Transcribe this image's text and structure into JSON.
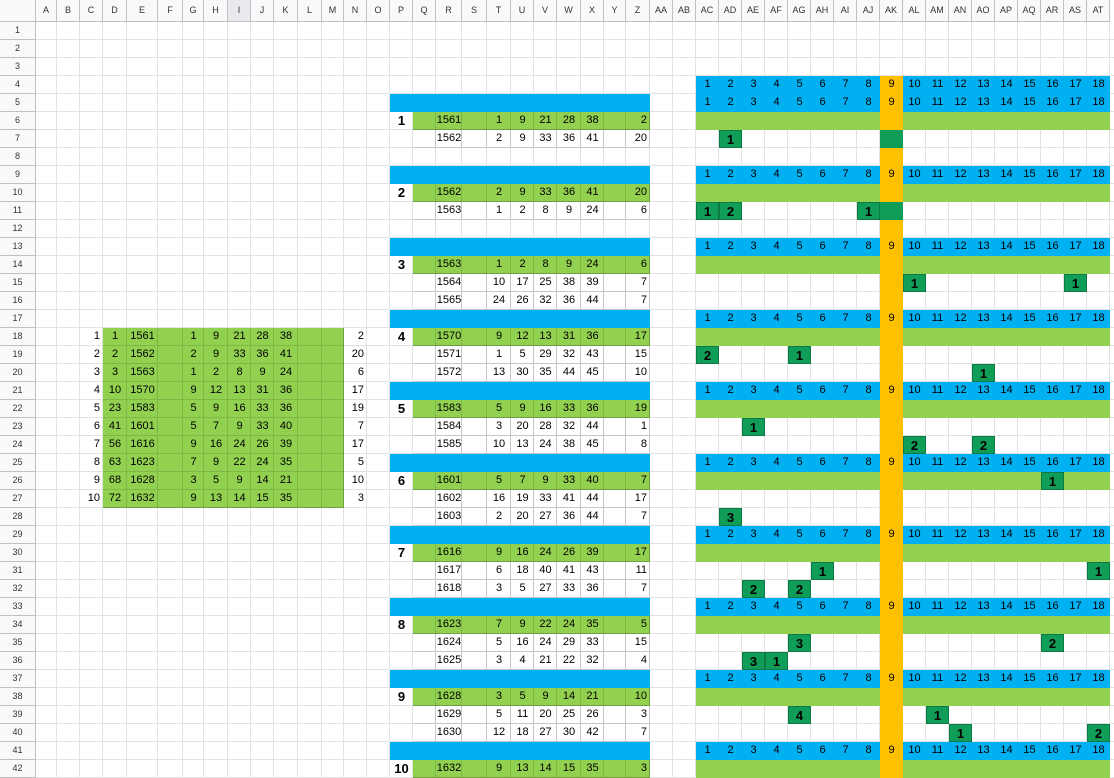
{
  "colors": {
    "green": "#92d050",
    "blue": "#00b0f0",
    "orange": "#ffc000",
    "mark": "#0f9d58",
    "header": "#f8f9fa"
  },
  "columns": [
    "A",
    "B",
    "C",
    "D",
    "E",
    "F",
    "G",
    "H",
    "I",
    "J",
    "K",
    "L",
    "M",
    "N",
    "O",
    "P",
    "Q",
    "R",
    "S",
    "T",
    "U",
    "V",
    "W",
    "X",
    "Y",
    "Z",
    "AA",
    "AB",
    "AC",
    "AD",
    "AE",
    "AF",
    "AG",
    "AH",
    "AI",
    "AJ",
    "AK",
    "AL",
    "AM",
    "AN",
    "AO",
    "AP",
    "AQ",
    "AR",
    "AS",
    "AT"
  ],
  "selected_column": "I",
  "row_numbers": [
    1,
    2,
    3,
    4,
    5,
    6,
    7,
    8,
    9,
    10,
    11,
    12,
    13,
    14,
    15,
    16,
    17,
    18,
    19,
    20,
    21,
    22,
    23,
    24,
    25,
    26,
    27,
    28,
    29,
    30,
    31,
    32,
    33,
    34,
    35,
    36,
    37,
    38,
    39,
    40,
    41,
    42
  ],
  "summary_table": [
    {
      "idx": "1",
      "n": "1",
      "draw": "1561",
      "nums": [
        "1",
        "9",
        "21",
        "28",
        "38"
      ],
      "bonus": "2"
    },
    {
      "idx": "2",
      "n": "2",
      "draw": "1562",
      "nums": [
        "2",
        "9",
        "33",
        "36",
        "41"
      ],
      "bonus": "20"
    },
    {
      "idx": "3",
      "n": "3",
      "draw": "1563",
      "nums": [
        "1",
        "2",
        "8",
        "9",
        "24"
      ],
      "bonus": "6"
    },
    {
      "idx": "4",
      "n": "10",
      "draw": "1570",
      "nums": [
        "9",
        "12",
        "13",
        "31",
        "36"
      ],
      "bonus": "17"
    },
    {
      "idx": "5",
      "n": "23",
      "draw": "1583",
      "nums": [
        "5",
        "9",
        "16",
        "33",
        "36"
      ],
      "bonus": "19"
    },
    {
      "idx": "6",
      "n": "41",
      "draw": "1601",
      "nums": [
        "5",
        "7",
        "9",
        "33",
        "40"
      ],
      "bonus": "7"
    },
    {
      "idx": "7",
      "n": "56",
      "draw": "1616",
      "nums": [
        "9",
        "16",
        "24",
        "26",
        "39"
      ],
      "bonus": "17"
    },
    {
      "idx": "8",
      "n": "63",
      "draw": "1623",
      "nums": [
        "7",
        "9",
        "22",
        "24",
        "35"
      ],
      "bonus": "5"
    },
    {
      "idx": "9",
      "n": "68",
      "draw": "1628",
      "nums": [
        "3",
        "5",
        "9",
        "14",
        "21"
      ],
      "bonus": "10"
    },
    {
      "idx": "10",
      "n": "72",
      "draw": "1632",
      "nums": [
        "9",
        "13",
        "14",
        "15",
        "35"
      ],
      "bonus": "3"
    }
  ],
  "blocks": [
    {
      "label": "1",
      "rows": [
        {
          "draw": "1561",
          "nums": [
            "1",
            "9",
            "21",
            "28",
            "38"
          ],
          "bonus": "2"
        },
        {
          "draw": "1562",
          "nums": [
            "2",
            "9",
            "33",
            "36",
            "41"
          ],
          "bonus": "20"
        }
      ]
    },
    {
      "label": "2",
      "rows": [
        {
          "draw": "1562",
          "nums": [
            "2",
            "9",
            "33",
            "36",
            "41"
          ],
          "bonus": "20"
        },
        {
          "draw": "1563",
          "nums": [
            "1",
            "2",
            "8",
            "9",
            "24"
          ],
          "bonus": "6"
        }
      ]
    },
    {
      "label": "3",
      "rows": [
        {
          "draw": "1563",
          "nums": [
            "1",
            "2",
            "8",
            "9",
            "24"
          ],
          "bonus": "6"
        },
        {
          "draw": "1564",
          "nums": [
            "10",
            "17",
            "25",
            "38",
            "39"
          ],
          "bonus": "7"
        },
        {
          "draw": "1565",
          "nums": [
            "24",
            "26",
            "32",
            "36",
            "44"
          ],
          "bonus": "7"
        }
      ]
    },
    {
      "label": "4",
      "rows": [
        {
          "draw": "1570",
          "nums": [
            "9",
            "12",
            "13",
            "31",
            "36"
          ],
          "bonus": "17"
        },
        {
          "draw": "1571",
          "nums": [
            "1",
            "5",
            "29",
            "32",
            "43"
          ],
          "bonus": "15"
        },
        {
          "draw": "1572",
          "nums": [
            "13",
            "30",
            "35",
            "44",
            "45"
          ],
          "bonus": "10"
        }
      ]
    },
    {
      "label": "5",
      "rows": [
        {
          "draw": "1583",
          "nums": [
            "5",
            "9",
            "16",
            "33",
            "36"
          ],
          "bonus": "19"
        },
        {
          "draw": "1584",
          "nums": [
            "3",
            "20",
            "28",
            "32",
            "44"
          ],
          "bonus": "1"
        },
        {
          "draw": "1585",
          "nums": [
            "10",
            "13",
            "24",
            "38",
            "45"
          ],
          "bonus": "8"
        }
      ]
    },
    {
      "label": "6",
      "rows": [
        {
          "draw": "1601",
          "nums": [
            "5",
            "7",
            "9",
            "33",
            "40"
          ],
          "bonus": "7"
        },
        {
          "draw": "1602",
          "nums": [
            "16",
            "19",
            "33",
            "41",
            "44"
          ],
          "bonus": "17"
        },
        {
          "draw": "1603",
          "nums": [
            "2",
            "20",
            "27",
            "36",
            "44"
          ],
          "bonus": "7"
        }
      ]
    },
    {
      "label": "7",
      "rows": [
        {
          "draw": "1616",
          "nums": [
            "9",
            "16",
            "24",
            "26",
            "39"
          ],
          "bonus": "17"
        },
        {
          "draw": "1617",
          "nums": [
            "6",
            "18",
            "40",
            "41",
            "43"
          ],
          "bonus": "11"
        },
        {
          "draw": "1618",
          "nums": [
            "3",
            "5",
            "27",
            "33",
            "36"
          ],
          "bonus": "7"
        }
      ]
    },
    {
      "label": "8",
      "rows": [
        {
          "draw": "1623",
          "nums": [
            "7",
            "9",
            "22",
            "24",
            "35"
          ],
          "bonus": "5"
        },
        {
          "draw": "1624",
          "nums": [
            "5",
            "16",
            "24",
            "29",
            "33"
          ],
          "bonus": "15"
        },
        {
          "draw": "1625",
          "nums": [
            "3",
            "4",
            "21",
            "22",
            "32"
          ],
          "bonus": "4"
        }
      ]
    },
    {
      "label": "9",
      "rows": [
        {
          "draw": "1628",
          "nums": [
            "3",
            "5",
            "9",
            "14",
            "21"
          ],
          "bonus": "10"
        },
        {
          "draw": "1629",
          "nums": [
            "5",
            "11",
            "20",
            "25",
            "26"
          ],
          "bonus": "3"
        },
        {
          "draw": "1630",
          "nums": [
            "12",
            "18",
            "27",
            "30",
            "42"
          ],
          "bonus": "7"
        }
      ]
    },
    {
      "label": "10",
      "rows": [
        {
          "draw": "1632",
          "nums": [
            "9",
            "13",
            "14",
            "15",
            "35"
          ],
          "bonus": "3"
        }
      ]
    }
  ],
  "number_header": [
    "1",
    "2",
    "3",
    "4",
    "5",
    "6",
    "7",
    "8",
    "9",
    "10",
    "11",
    "12",
    "13",
    "14",
    "15",
    "16",
    "17",
    "18"
  ],
  "marks": [
    {
      "row": 7,
      "col": "AD",
      "v": "1"
    },
    {
      "row": 11,
      "col": "AC",
      "v": "1"
    },
    {
      "row": 11,
      "col": "AD",
      "v": "2"
    },
    {
      "row": 11,
      "col": "AJ",
      "v": "1"
    },
    {
      "row": 15,
      "col": "AL",
      "v": "1"
    },
    {
      "row": 15,
      "col": "AS",
      "v": "1"
    },
    {
      "row": 19,
      "col": "AC",
      "v": "2"
    },
    {
      "row": 19,
      "col": "AG",
      "v": "1"
    },
    {
      "row": 20,
      "col": "AO",
      "v": "1"
    },
    {
      "row": 23,
      "col": "AE",
      "v": "1"
    },
    {
      "row": 24,
      "col": "AL",
      "v": "2"
    },
    {
      "row": 24,
      "col": "AO",
      "v": "2"
    },
    {
      "row": 26,
      "col": "AR",
      "v": "1"
    },
    {
      "row": 28,
      "col": "AD",
      "v": "3"
    },
    {
      "row": 31,
      "col": "AH",
      "v": "1"
    },
    {
      "row": 31,
      "col": "AT",
      "v": "1"
    },
    {
      "row": 32,
      "col": "AE",
      "v": "2"
    },
    {
      "row": 32,
      "col": "AG",
      "v": "2"
    },
    {
      "row": 35,
      "col": "AG",
      "v": "3"
    },
    {
      "row": 35,
      "col": "AR",
      "v": "2"
    },
    {
      "row": 36,
      "col": "AE",
      "v": "3"
    },
    {
      "row": 36,
      "col": "AF",
      "v": "1"
    },
    {
      "row": 39,
      "col": "AG",
      "v": "4"
    },
    {
      "row": 39,
      "col": "AM",
      "v": "1"
    },
    {
      "row": 40,
      "col": "AN",
      "v": "1"
    },
    {
      "row": 40,
      "col": "AT",
      "v": "2"
    }
  ]
}
